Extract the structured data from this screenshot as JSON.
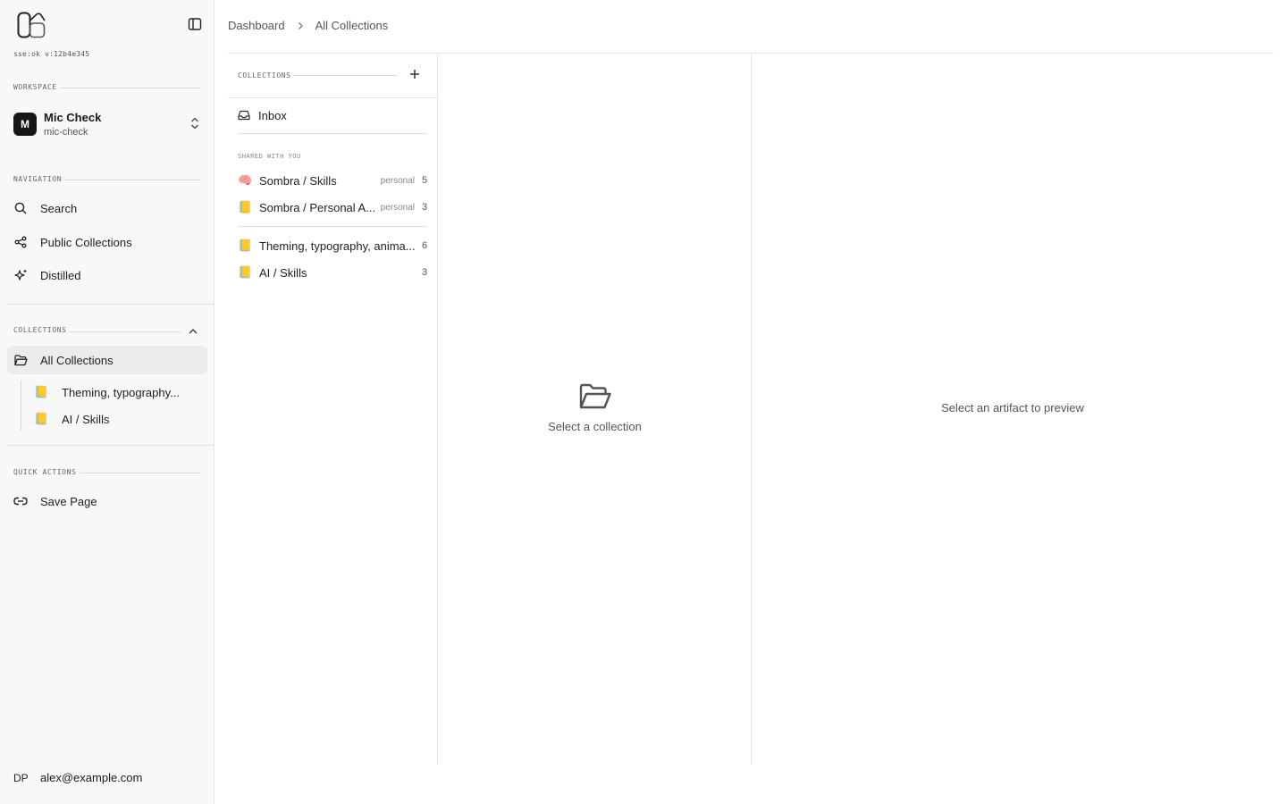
{
  "sidebar": {
    "status": "sse:ok v:12b4e345",
    "workspace_label": "WORKSPACE",
    "workspace": {
      "initial": "M",
      "name": "Mic Check",
      "slug": "mic-check"
    },
    "navigation_label": "NAVIGATION",
    "nav_items": [
      {
        "label": "Search",
        "icon": "search-icon"
      },
      {
        "label": "Public Collections",
        "icon": "share-icon"
      },
      {
        "label": "Distilled",
        "icon": "sparkles-icon"
      }
    ],
    "collections_label": "COLLECTIONS",
    "all_collections": "All Collections",
    "sub_collections": [
      {
        "emoji": "📒",
        "label": "Theming, typography..."
      },
      {
        "emoji": "📒",
        "label": "AI / Skills"
      }
    ],
    "quick_actions_label": "QUICK ACTIONS",
    "quick_actions": [
      {
        "label": "Save Page",
        "icon": "link-icon"
      }
    ],
    "user": {
      "initials": "DP",
      "email": "alex@example.com"
    }
  },
  "breadcrumb": {
    "root": "Dashboard",
    "current": "All Collections"
  },
  "collections_panel": {
    "header": "COLLECTIONS",
    "inbox": "Inbox",
    "shared_label": "SHARED WITH YOU",
    "shared": [
      {
        "emoji": "🧠",
        "name": "Sombra / Skills",
        "tag": "personal",
        "count": "5"
      },
      {
        "emoji": "📒",
        "name": "Sombra / Personal A...",
        "tag": "personal",
        "count": "3"
      }
    ],
    "own": [
      {
        "emoji": "📒",
        "name": "Theming, typography, anima...",
        "count": "6"
      },
      {
        "emoji": "📒",
        "name": "AI / Skills",
        "count": "3"
      }
    ]
  },
  "middle": {
    "empty_text": "Select a collection"
  },
  "preview": {
    "empty_text": "Select an artifact to preview"
  }
}
